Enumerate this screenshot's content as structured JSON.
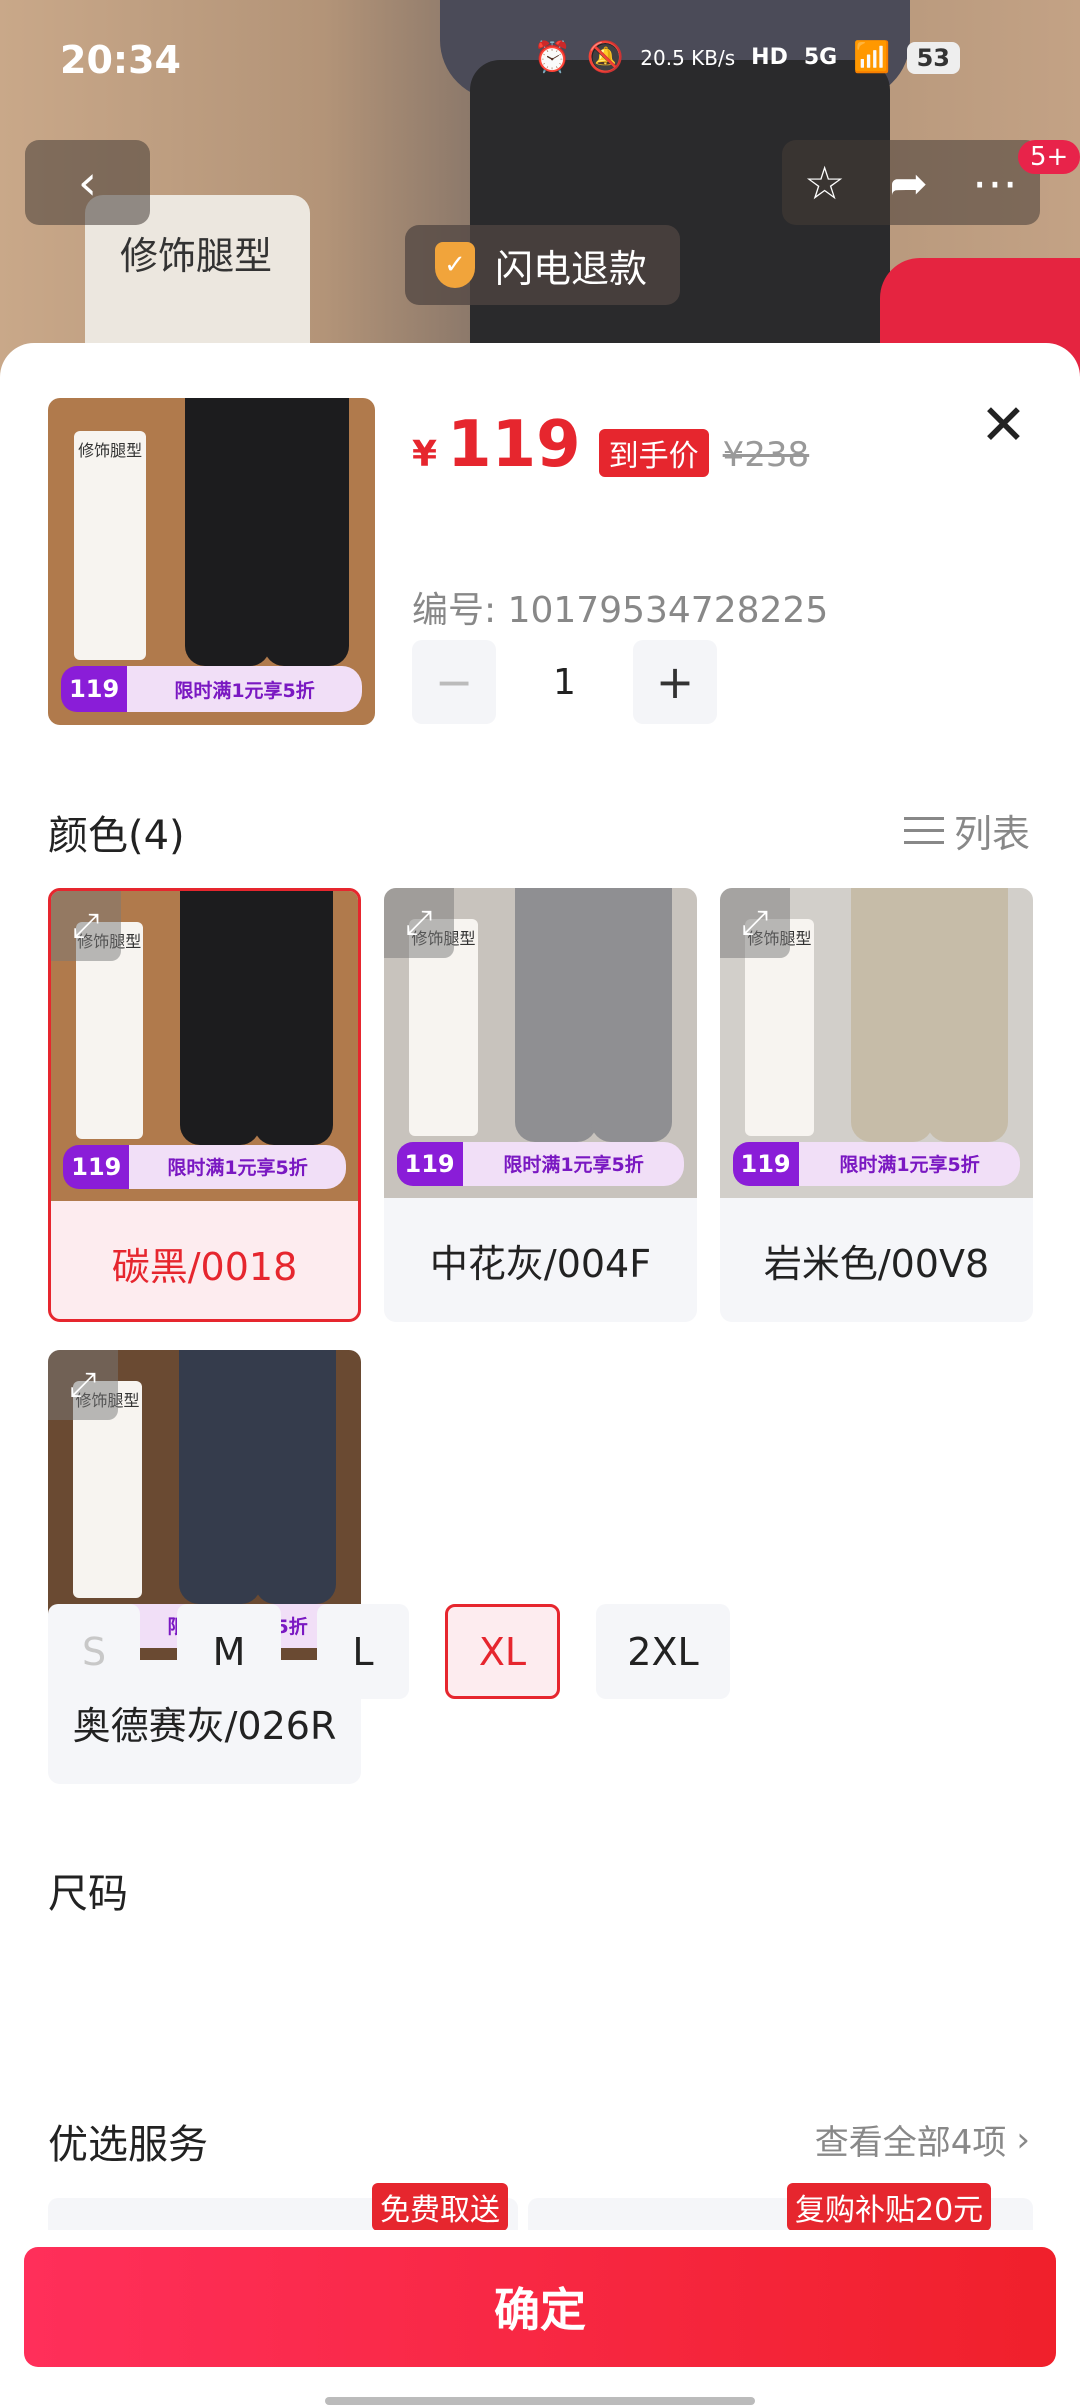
{
  "status": {
    "time": "20:34",
    "net_speed": "20.5 KB/s",
    "hd": "HD",
    "net_type": "5G",
    "battery": "53"
  },
  "topbar": {
    "badge": "5+",
    "refund_text": "闪电退款",
    "leg_card": "修饰腿型"
  },
  "product": {
    "currency": "¥",
    "price": "119",
    "price_tag": "到手价",
    "old_price": "¥238",
    "sku_code": "编号: 10179534728225",
    "quantity": "1"
  },
  "promo": {
    "price": "119",
    "text": "限时满1元享5折",
    "card_title": "修饰腿型"
  },
  "color_section": {
    "title": "颜色(4)",
    "view_mode": "列表"
  },
  "variants": [
    {
      "label": "碳黑/0018",
      "pants": "#1c1c1e",
      "bg": "#b07a4c"
    },
    {
      "label": "中花灰/004F",
      "pants": "#8f8f92",
      "bg": "#c8c3bd"
    },
    {
      "label": "岩米色/00V8",
      "pants": "#c6bca8",
      "bg": "#d2cfca"
    },
    {
      "label": "奥德赛灰/026R",
      "pants": "#353c4c",
      "bg": "#6a4a32"
    }
  ],
  "size_section": {
    "title": "尺码",
    "sizes": [
      "S",
      "M",
      "L",
      "XL",
      "2XL"
    ]
  },
  "services": {
    "title": "优选服务",
    "more": "查看全部4项",
    "tag1": "免费取送",
    "tag2": "复购补贴20元"
  },
  "confirm_label": "确定",
  "colors": {
    "accent": "#e6262e",
    "promo_purple": "#8a1dd8"
  }
}
